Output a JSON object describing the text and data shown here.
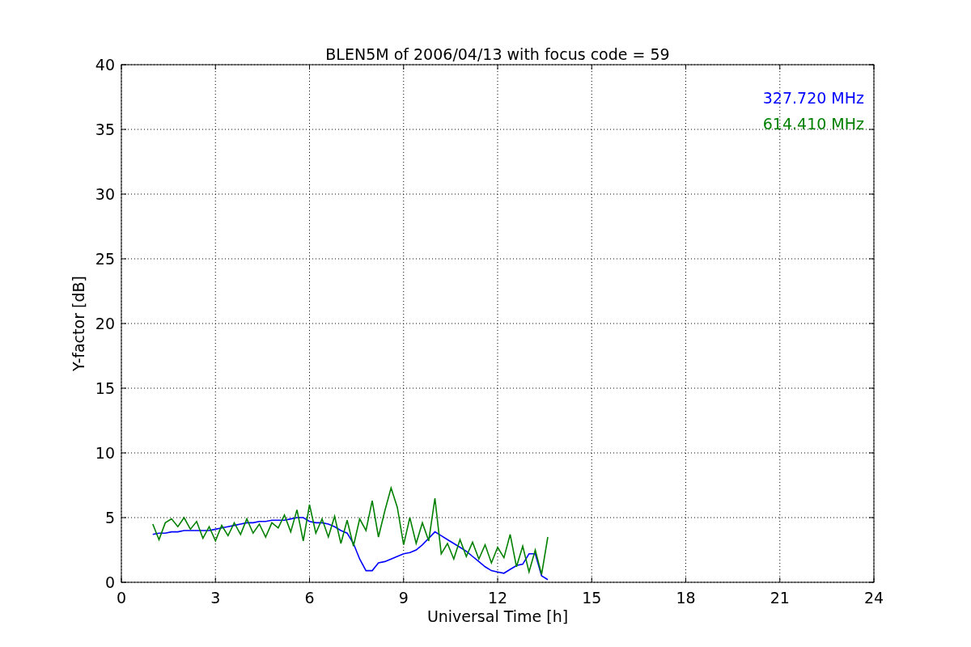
{
  "chart_data": {
    "type": "line",
    "title": "BLEN5M of 2006/04/13 with focus code = 59",
    "xlabel": "Universal Time [h]",
    "ylabel": "Y-factor [dB]",
    "x": [
      1.0,
      1.2,
      1.4,
      1.6,
      1.8,
      2.0,
      2.2,
      2.4,
      2.6,
      2.8,
      3.0,
      3.2,
      3.4,
      3.6,
      3.8,
      4.0,
      4.2,
      4.4,
      4.6,
      4.8,
      5.0,
      5.2,
      5.4,
      5.6,
      5.8,
      6.0,
      6.2,
      6.4,
      6.6,
      6.8,
      7.0,
      7.2,
      7.4,
      7.6,
      7.8,
      8.0,
      8.2,
      8.4,
      8.6,
      8.8,
      9.0,
      9.2,
      9.4,
      9.6,
      9.8,
      10.0,
      10.2,
      10.4,
      10.6,
      10.8,
      11.0,
      11.2,
      11.4,
      11.6,
      11.8,
      12.0,
      12.2,
      12.4,
      12.6,
      12.8,
      13.0,
      13.2,
      13.4,
      13.6
    ],
    "series": [
      {
        "name": "327.720 MHz",
        "color": "#0000ff",
        "values": [
          3.7,
          3.8,
          3.8,
          3.9,
          3.9,
          4.0,
          4.0,
          4.0,
          4.0,
          4.0,
          4.1,
          4.2,
          4.3,
          4.4,
          4.5,
          4.6,
          4.6,
          4.7,
          4.7,
          4.8,
          4.8,
          4.8,
          4.9,
          5.0,
          5.0,
          4.7,
          4.6,
          4.6,
          4.5,
          4.3,
          4.0,
          3.8,
          3.0,
          1.8,
          0.9,
          0.9,
          1.5,
          1.6,
          1.8,
          2.0,
          2.2,
          2.3,
          2.5,
          2.9,
          3.4,
          3.9,
          3.6,
          3.3,
          3.0,
          2.7,
          2.4,
          2.0,
          1.6,
          1.2,
          0.9,
          0.8,
          0.7,
          1.0,
          1.3,
          1.4,
          2.2,
          2.2,
          0.5,
          0.2
        ]
      },
      {
        "name": "614.410 MHz",
        "color": "#008000",
        "values": [
          4.5,
          3.3,
          4.6,
          4.9,
          4.3,
          5.0,
          4.1,
          4.7,
          3.4,
          4.3,
          3.2,
          4.4,
          3.6,
          4.6,
          3.7,
          4.9,
          3.8,
          4.5,
          3.5,
          4.6,
          4.2,
          5.2,
          3.9,
          5.6,
          3.2,
          6.0,
          3.8,
          4.9,
          3.5,
          5.1,
          3.0,
          4.8,
          2.8,
          4.9,
          4.0,
          6.3,
          3.5,
          5.5,
          7.3,
          5.8,
          2.9,
          5.0,
          3.0,
          4.6,
          3.2,
          6.5,
          2.2,
          3.0,
          1.8,
          3.3,
          2.0,
          3.1,
          1.8,
          2.9,
          1.5,
          2.7,
          1.9,
          3.7,
          1.2,
          2.8,
          0.8,
          2.5,
          0.6,
          3.5
        ]
      }
    ],
    "xlim": [
      0,
      24
    ],
    "ylim": [
      0,
      40
    ],
    "xticks": [
      0,
      3,
      6,
      9,
      12,
      15,
      18,
      21,
      24
    ],
    "yticks": [
      0,
      5,
      10,
      15,
      20,
      25,
      30,
      35,
      40
    ],
    "grid": true
  }
}
